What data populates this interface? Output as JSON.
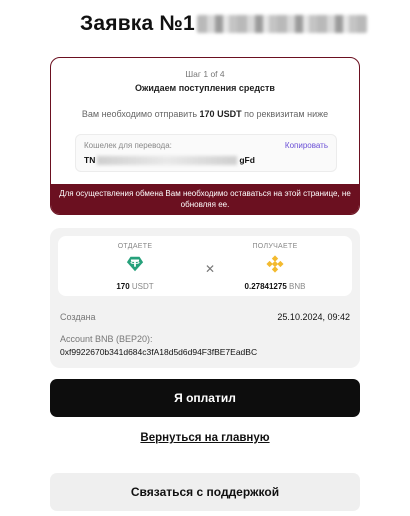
{
  "header": {
    "title": "Заявка №1"
  },
  "status_card": {
    "step": "Шаг 1 of 4",
    "status": "Ожидаем поступления средств",
    "instruction_prefix": "Вам необходимо отправить",
    "amount": "170 USDT",
    "instruction_suffix": "по реквизитам ниже",
    "wallet_label": "Кошелек для перевода:",
    "copy_label": "Копировать",
    "wallet_start": "TN",
    "wallet_end": "gFd",
    "warning": "Для осуществления обмена Вам необходимо оставаться на этой странице, не обновляя ее."
  },
  "exchange": {
    "give_label": "ОТДАЕТЕ",
    "give_amount": "170",
    "give_currency": "USDT",
    "give_icon": "tether-icon",
    "get_label": "ПОЛУЧАЕТЕ",
    "get_amount": "0.27841275",
    "get_currency": "BNB",
    "get_icon": "bnb-icon",
    "created_label": "Создана",
    "created_value": "25.10.2024, 09:42",
    "account_label": "Account BNB (BEP20):",
    "account_value": "0xf9922670b341d684c3fA18d5d6d94F3fBE7EadBC"
  },
  "actions": {
    "paid": "Я оплатил",
    "back": "Вернуться на главную",
    "support": "Связаться с поддержкой"
  },
  "colors": {
    "accent": "#6b1020",
    "tether": "#26a17b",
    "bnb": "#f3ba2f"
  }
}
